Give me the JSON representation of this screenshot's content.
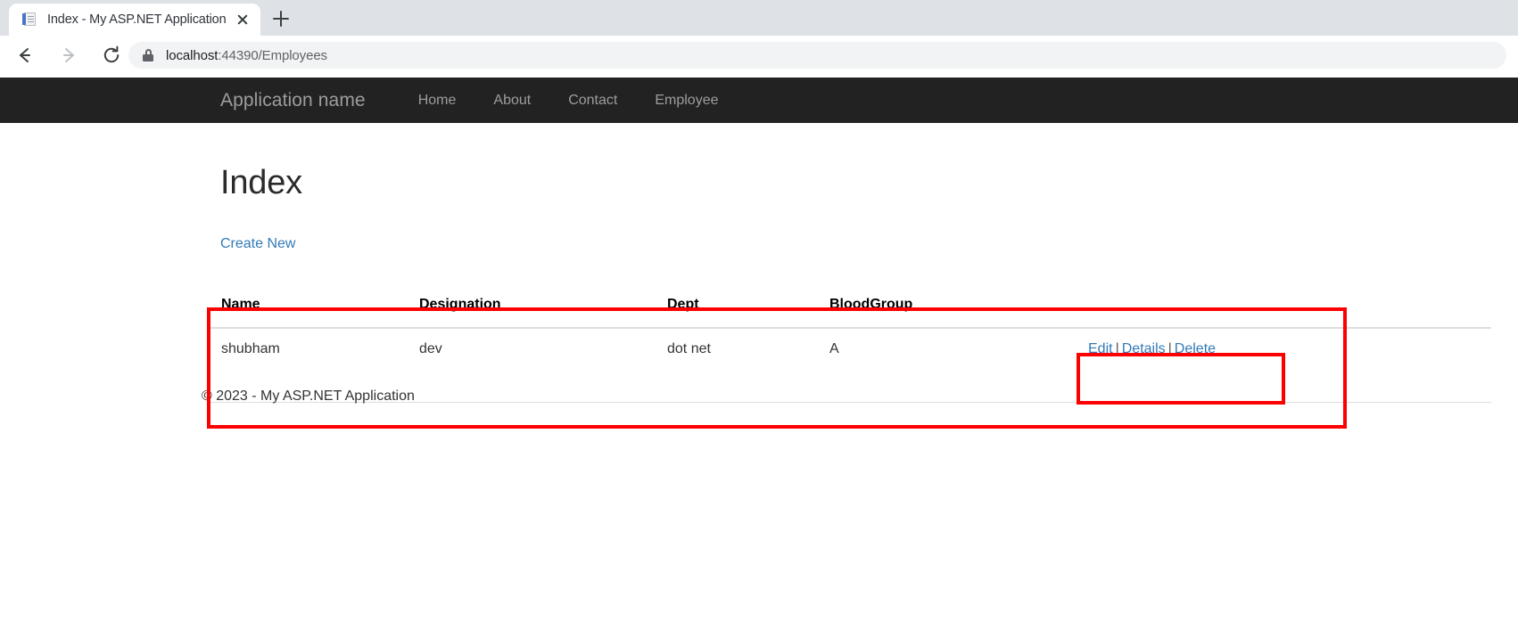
{
  "browser": {
    "tab": {
      "title": "Index - My ASP.NET Application",
      "favicon": "document-favicon",
      "close_label": "×",
      "new_tab_label": "+"
    },
    "toolbar": {
      "back": "back-arrow-icon",
      "forward": "forward-arrow-icon",
      "reload": "reload-icon",
      "lock": "lock-icon",
      "url_host": "localhost",
      "url_rest": ":44390/Employees"
    }
  },
  "site": {
    "brand": "Application name",
    "nav": [
      {
        "label": "Home"
      },
      {
        "label": "About"
      },
      {
        "label": "Contact"
      },
      {
        "label": "Employee"
      }
    ]
  },
  "page": {
    "title": "Index",
    "create_new": "Create New",
    "footer": "© 2023 - My ASP.NET Application"
  },
  "table": {
    "headers": [
      "Name",
      "Designation",
      "Dept",
      "BloodGroup",
      ""
    ],
    "rows": [
      {
        "name": "shubham",
        "designation": "dev",
        "dept": "dot net",
        "bloodgroup": "A",
        "actions": {
          "edit": "Edit",
          "details": "Details",
          "delete": "Delete",
          "separator": "|"
        }
      }
    ]
  },
  "annotations": {
    "color": "#fd0000",
    "boxes": [
      {
        "name": "table-highlight"
      },
      {
        "name": "actions-highlight"
      }
    ]
  },
  "colors": {
    "navbar_bg": "#222222",
    "navbar_text": "#9d9d9d",
    "link": "#337ab7",
    "annotation": "#fd0000",
    "tabstrip_bg": "#dee1e6",
    "omnibox_bg": "#f1f3f4"
  }
}
